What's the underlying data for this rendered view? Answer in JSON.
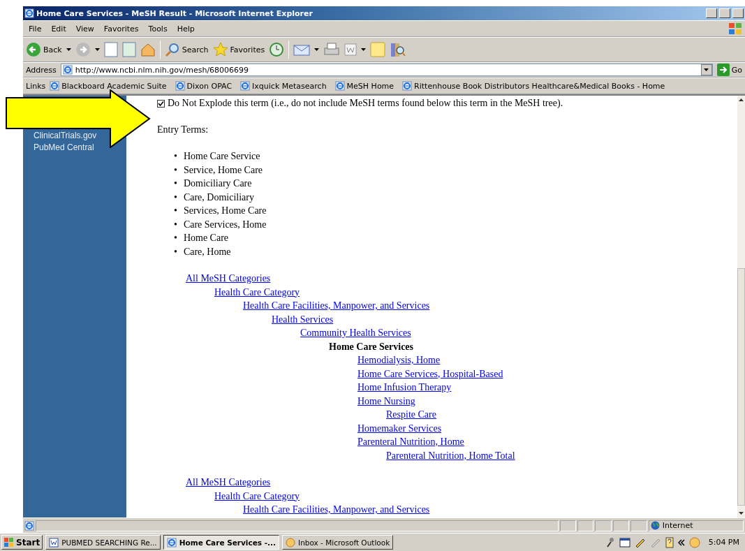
{
  "window": {
    "title": "Home Care Services - MeSH Result - Microsoft Internet Explorer"
  },
  "menu": [
    "File",
    "Edit",
    "View",
    "Favorites",
    "Tools",
    "Help"
  ],
  "toolbar": {
    "back": "Back",
    "search": "Search",
    "favorites": "Favorites"
  },
  "address": {
    "label": "Address",
    "value": "http://www.ncbi.nlm.nih.gov/mesh/68006699",
    "go": "Go"
  },
  "links": {
    "label": "Links",
    "items": [
      "Blackboard Academic Suite",
      "Dixon OPAC",
      "Ixquick Metasearch",
      "MeSH Home",
      "Rittenhouse Book Distributors Healthcare&Medical Books - Home"
    ]
  },
  "sidebar": {
    "items": [
      "ClinicalTrials.gov",
      "PubMed Central"
    ]
  },
  "explode": {
    "checked": true,
    "label": "Do Not Explode this term (i.e., do not include MeSH terms found below this term in the MeSH tree)."
  },
  "entry_terms": {
    "heading": "Entry Terms:",
    "bullet": "•",
    "items": [
      "Home Care Service",
      "Service, Home Care",
      "Domiciliary Care",
      "Care, Domiciliary",
      "Services, Home Care",
      "Care Services, Home",
      "Home Care",
      "Care, Home"
    ]
  },
  "trees": [
    {
      "kind": "link",
      "label": "All MeSH Categories",
      "children": [
        {
          "kind": "link",
          "label": "Health Care Category",
          "children": [
            {
              "kind": "link",
              "label": "Health Care Facilities, Manpower, and Services",
              "children": [
                {
                  "kind": "link",
                  "label": "Health Services",
                  "children": [
                    {
                      "kind": "link",
                      "label": "Community Health Services",
                      "children": [
                        {
                          "kind": "current",
                          "label": "Home Care Services",
                          "children": [
                            {
                              "kind": "link",
                              "label": "Hemodialysis, Home"
                            },
                            {
                              "kind": "link",
                              "label": "Home Care Services, Hospital-Based"
                            },
                            {
                              "kind": "link",
                              "label": "Home Infusion Therapy"
                            },
                            {
                              "kind": "link",
                              "label": "Home Nursing",
                              "children": [
                                {
                                  "kind": "link",
                                  "label": "Respite Care"
                                }
                              ]
                            },
                            {
                              "kind": "link",
                              "label": "Homemaker Services"
                            },
                            {
                              "kind": "link",
                              "label": "Parenteral Nutrition, Home",
                              "children": [
                                {
                                  "kind": "link",
                                  "label": "Parenteral Nutrition, Home Total"
                                }
                              ]
                            }
                          ]
                        }
                      ]
                    }
                  ]
                }
              ]
            }
          ]
        }
      ]
    },
    {
      "kind": "link",
      "label": "All MeSH Categories",
      "children": [
        {
          "kind": "link",
          "label": "Health Care Category",
          "children": [
            {
              "kind": "link",
              "label": "Health Care Facilities, Manpower, and Services"
            }
          ]
        }
      ]
    }
  ],
  "status_bar": {
    "zone": "Internet"
  },
  "taskbar": {
    "start": "Start",
    "tasks": [
      {
        "label": "PUBMED SEARCHING Re...",
        "kind": "word",
        "selected": false
      },
      {
        "label": "Home Care Services -...",
        "kind": "ie",
        "selected": true
      },
      {
        "label": "Inbox - Microsoft Outlook",
        "kind": "outlook",
        "selected": false
      }
    ],
    "clock": "5:04 PM"
  }
}
